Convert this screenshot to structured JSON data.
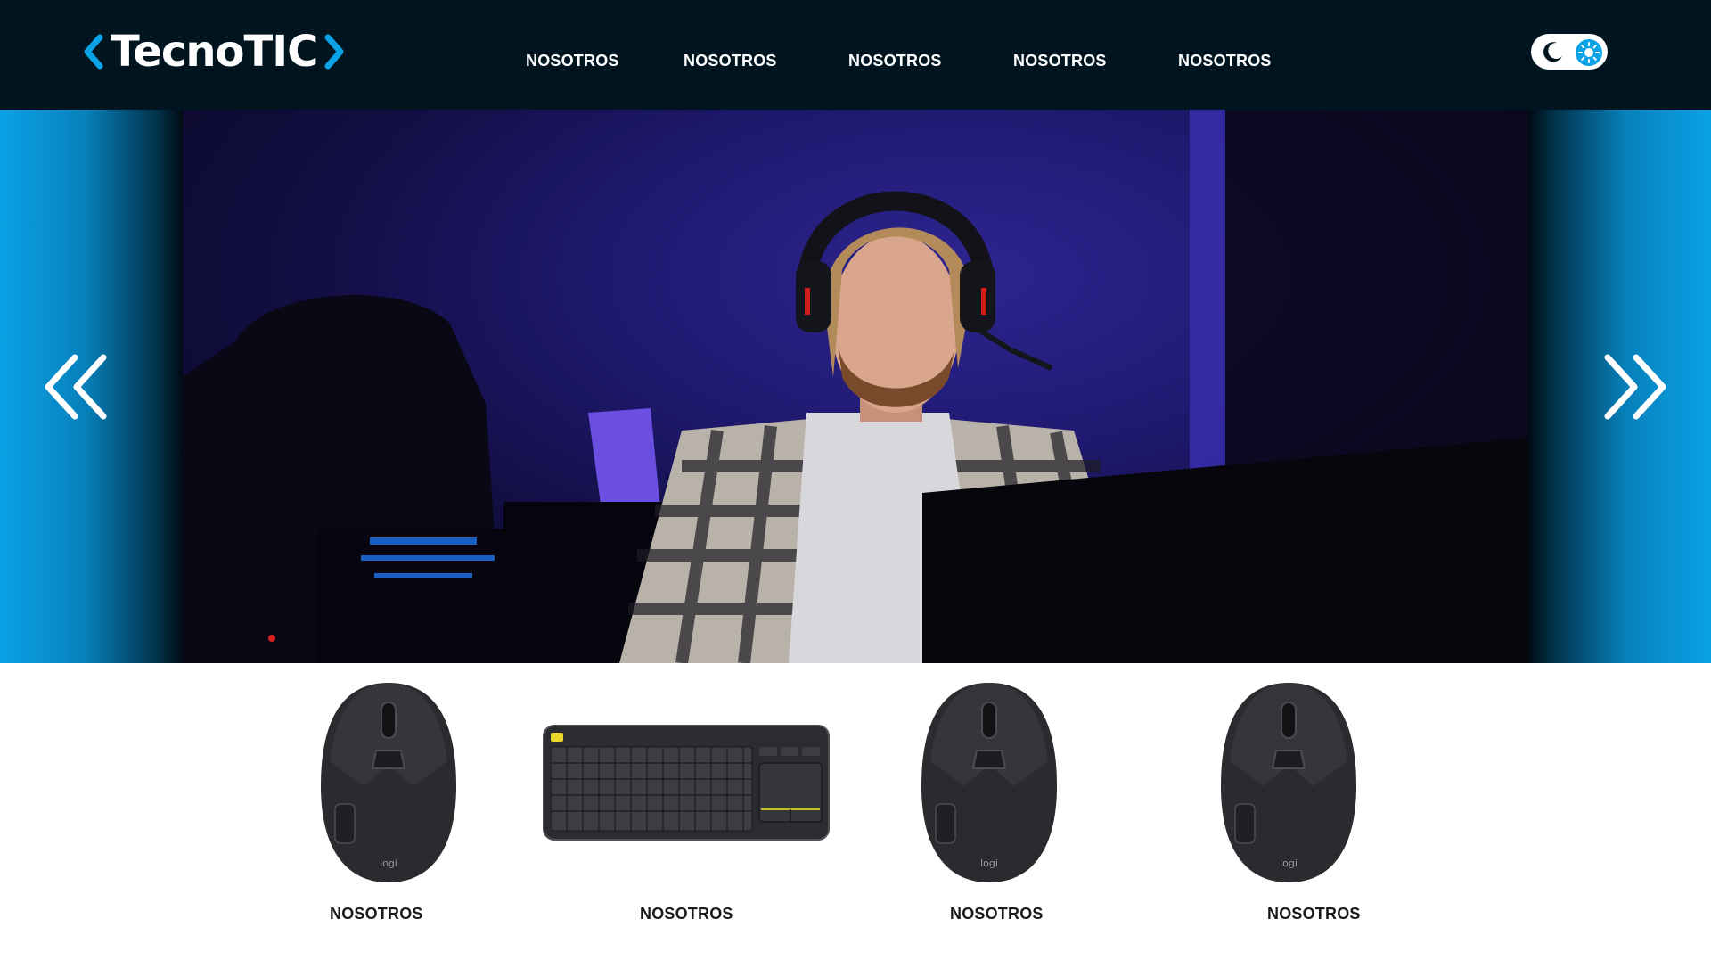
{
  "brand": {
    "logo_text": "TecnoTIC",
    "accent_color": "#0aa3e6",
    "header_bg": "#011520"
  },
  "nav": {
    "items": [
      {
        "label": "NOSOTROS"
      },
      {
        "label": "NOSOTROS"
      },
      {
        "label": "NOSOTROS"
      },
      {
        "label": "NOSOTROS"
      },
      {
        "label": "NOSOTROS"
      }
    ]
  },
  "theme_toggle": {
    "icons": [
      "moon-icon",
      "sun-icon"
    ],
    "active": "light"
  },
  "hero": {
    "image": "person-wearing-headset-at-computer",
    "prev_icon": "double-chevron-left-icon",
    "next_icon": "double-chevron-right-icon"
  },
  "products": [
    {
      "image": "mouse",
      "label": "NOSOTROS"
    },
    {
      "image": "keyboard",
      "label": "NOSOTROS"
    },
    {
      "image": "mouse",
      "label": "NOSOTROS"
    },
    {
      "image": "mouse",
      "label": "NOSOTROS"
    }
  ]
}
